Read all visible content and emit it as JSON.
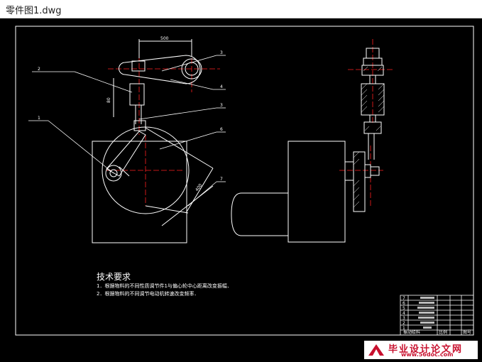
{
  "window": {
    "title": "零件图1.dwg"
  },
  "drawing": {
    "dimensions": {
      "top": "500",
      "vertical": "80",
      "diagonal": "400"
    },
    "balloons": [
      "3",
      "2",
      "4",
      "3",
      "1",
      "6",
      "7"
    ],
    "tech_requirements": {
      "title": "技术要求",
      "line1": "1．根据物料的不同性质调节件1与偏心轮中心距离改变振幅．",
      "line2": "2．根据物料的不同调节电动机转速改变频率．"
    },
    "title_block": {
      "rows": [
        "7",
        "6",
        "5",
        "4",
        "3",
        "2",
        "1"
      ],
      "drawing_name": "振动给料",
      "scale_label": "比例",
      "sheet_label": "图号"
    }
  },
  "watermark": {
    "main": "毕业设计论文网",
    "url": "www.56doc.com"
  },
  "colors": {
    "background": "#000000",
    "lines": "#ffffff",
    "centerlines": "#ff2020",
    "watermark": "#c8102e"
  }
}
